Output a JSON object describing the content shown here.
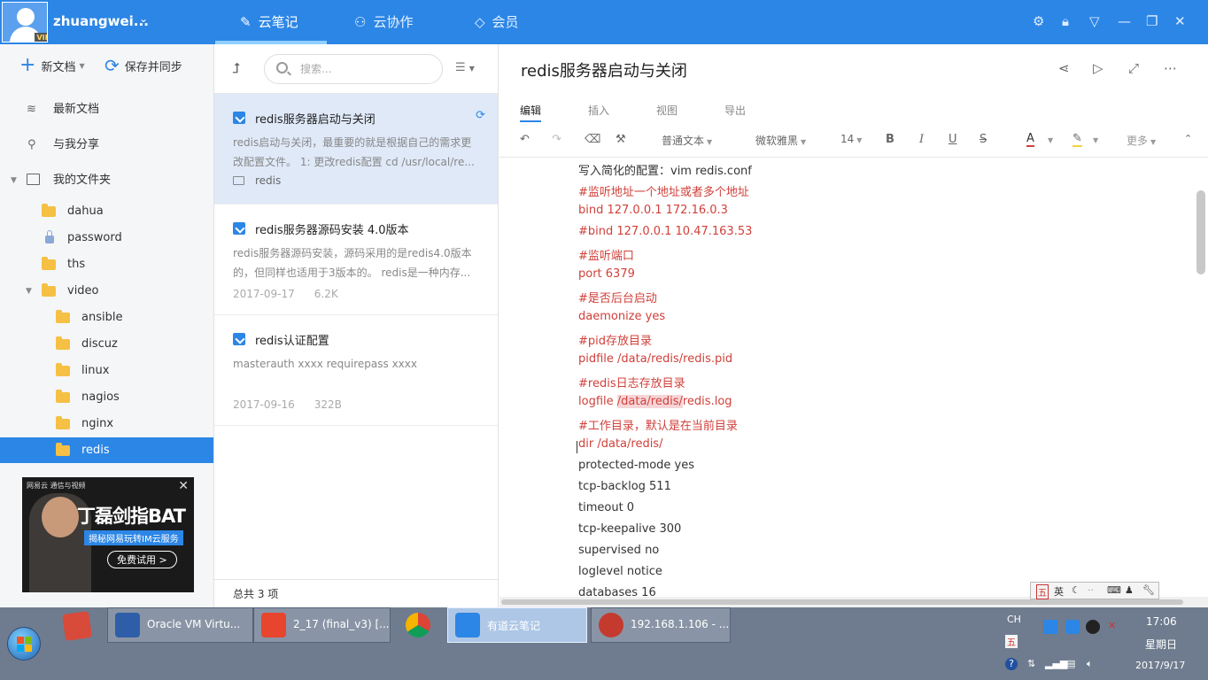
{
  "header": {
    "username": "zhuangwei...",
    "vip": "VIP",
    "tabs": [
      {
        "label": "云笔记",
        "icon": "pen-icon"
      },
      {
        "label": "云协作",
        "icon": "collaborate-icon"
      },
      {
        "label": "会员",
        "icon": "diamond-icon"
      }
    ]
  },
  "sidebar": {
    "new_doc": "新文档",
    "save_sync": "保存并同步",
    "items": [
      {
        "label": "最新文档"
      },
      {
        "label": "与我分享"
      },
      {
        "label": "我的文件夹"
      }
    ],
    "folders": [
      {
        "label": "dahua"
      },
      {
        "label": "password"
      },
      {
        "label": "ths"
      },
      {
        "label": "video"
      },
      {
        "label": "ansible"
      },
      {
        "label": "discuz"
      },
      {
        "label": "linux"
      },
      {
        "label": "nagios"
      },
      {
        "label": "nginx"
      },
      {
        "label": "redis"
      }
    ],
    "ad": {
      "brand": "网易云 通信与视频",
      "title": "丁磊剑指BAT",
      "subtitle": "揭秘网易玩转IM云服务",
      "button": "免费试用 >"
    }
  },
  "notelist": {
    "search_placeholder": "搜索...",
    "notes": [
      {
        "title": "redis服务器启动与关闭",
        "snippet": "redis启动与关闭，最重要的就是根据自己的需求更改配置文件。 1: 更改redis配置 cd /usr/local/re...",
        "folder": "redis"
      },
      {
        "title": "redis服务器源码安装 4.0版本",
        "snippet": "redis服务器源码安装，源码采用的是redis4.0版本的，但同样也适用于3版本的。 redis是一种内存...",
        "date": "2017-09-17",
        "size": "6.2K"
      },
      {
        "title": "redis认证配置",
        "snippet": "masterauth xxxx requirepass xxxx",
        "date": "2017-09-16",
        "size": "322B"
      }
    ],
    "footer": "总共 3 项"
  },
  "editor": {
    "title": "redis服务器启动与关闭",
    "tabs": [
      "编辑",
      "插入",
      "视图",
      "导出"
    ],
    "toolbar": {
      "paragraph_style": "普通文本",
      "font": "微软雅黑",
      "size": "14",
      "bold": "B",
      "italic": "I",
      "underline": "U",
      "strike": "S",
      "font_color": "A",
      "more": "更多"
    },
    "lines": [
      "写入简化的配置：vim redis.conf",
      "#监听地址一个地址或者多个地址",
      "bind 127.0.0.1 172.16.0.3",
      "#bind 127.0.0.1 10.47.163.53",
      "#监听端口",
      "port 6379",
      "#是否后台启动",
      "daemonize yes",
      "#pid存放目录",
      "pidfile /data/redis/redis.pid",
      "#redis日志存放目录",
      "logfile ",
      "#工作目录，默认是在当前目录",
      "dir /data/redis/",
      "protected-mode yes",
      "tcp-backlog 511",
      "timeout 0",
      "tcp-keepalive 300",
      "supervised no",
      "loglevel notice",
      "databases 16"
    ],
    "logfile_highlight": "/data/redis/",
    "logfile_tail": "redis.log"
  },
  "ime": {
    "mode1": "五",
    "mode2": "英"
  },
  "taskbar": {
    "tasks": [
      {
        "label": "Oracle VM Virtu..."
      },
      {
        "label": "2_17 (final_v3) [..."
      },
      {
        "label": ""
      },
      {
        "label": "有道云笔记"
      },
      {
        "label": "192.168.1.106 - ..."
      }
    ],
    "tray_lang": "CH",
    "time": "17:06",
    "day": "星期日",
    "date": "2017/9/17"
  }
}
